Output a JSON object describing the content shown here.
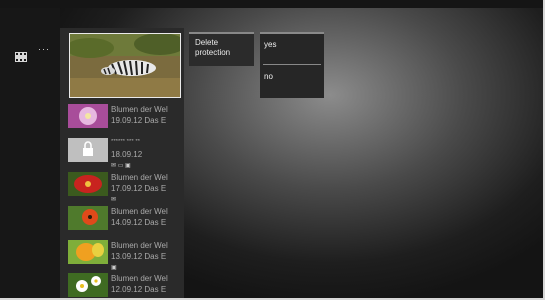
{
  "app": {
    "more_label": "···"
  },
  "menu": {
    "delete_protection_label": "Delete protection",
    "options": [
      "yes",
      "no"
    ]
  },
  "items": [
    {
      "title": "Blumen der Wel",
      "subtitle": "19.09.12 Das E",
      "icons": "",
      "thumb": "purple-flower"
    },
    {
      "title": "****** *** ** ",
      "subtitle": "18.09.12",
      "icons": "✉ ▭ ▣",
      "thumb": "locked"
    },
    {
      "title": "Blumen der Wel",
      "subtitle": "17.09.12 Das E",
      "icons": "✉",
      "thumb": "red-flower"
    },
    {
      "title": "Blumen der Wel",
      "subtitle": "14.09.12 Das E",
      "icons": "",
      "thumb": "orange-poppy"
    },
    {
      "title": "Blumen der Wel",
      "subtitle": "13.09.12 Das E",
      "icons": "▣",
      "thumb": "yellow-tulip"
    },
    {
      "title": "Blumen der Wel",
      "subtitle": "12.09.12 Das E",
      "icons": "",
      "thumb": "daisy"
    }
  ],
  "colors": {
    "accent": "#eaeaea",
    "panel": "#2a2a2a",
    "menu": "#262626"
  }
}
